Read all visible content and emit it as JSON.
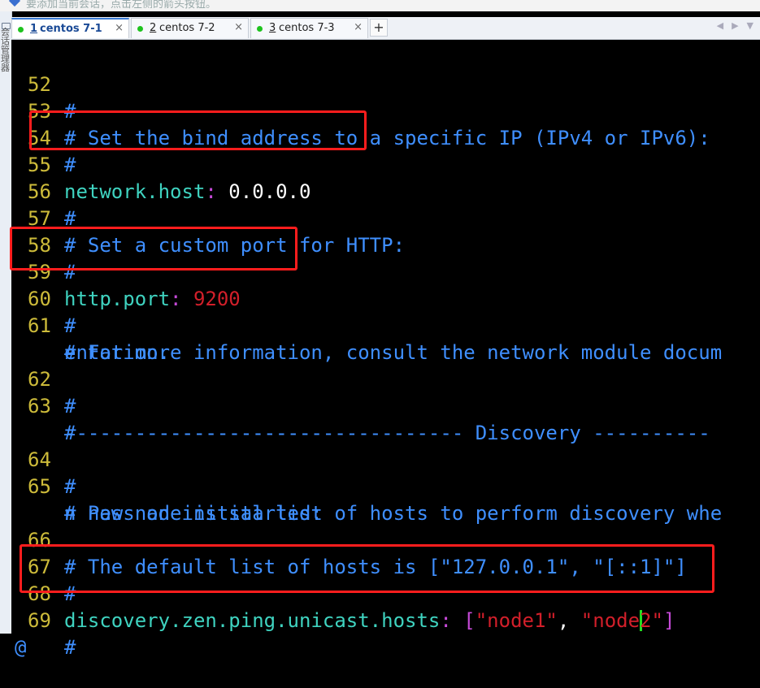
{
  "app": {
    "top_hint": "要添加当前会话，点击左侧的箭头按钮。",
    "side_label": "会话管理器"
  },
  "tabs": [
    {
      "num": "1",
      "label": "centos 7-1",
      "close": "×",
      "active": true
    },
    {
      "num": "2",
      "label": "centos 7-2",
      "close": "×",
      "active": false
    },
    {
      "num": "3",
      "label": "centos 7-3",
      "close": "×",
      "active": false
    }
  ],
  "add_tab_label": "+",
  "nav": {
    "prev": "◀",
    "next": "▶",
    "menu": "▼"
  },
  "terminal": {
    "lines": [
      {
        "num": "52",
        "text": "#"
      },
      {
        "num": "53",
        "text": "# Set the bind address to a specific IP (IPv4 or IPv6):"
      },
      {
        "num": "54",
        "text": "#"
      },
      {
        "num": "55",
        "key": "network.host",
        "colon": ":",
        "value": "0.0.0.0"
      },
      {
        "num": "56",
        "text": "#"
      },
      {
        "num": "57",
        "text": "# Set a custom port for HTTP:"
      },
      {
        "num": "58",
        "text": "#"
      },
      {
        "num": "59",
        "key": "http.port",
        "colon": ":",
        "value": "9200"
      },
      {
        "num": "60",
        "text": "#"
      },
      {
        "num": "61",
        "text": "# For more information, consult the network module docum",
        "cont": "entation."
      },
      {
        "num": "62",
        "text": "#"
      },
      {
        "num": "63",
        "text": "# -------------------------------- Discovery ----------",
        "cont": "----------------------"
      },
      {
        "num": "64",
        "text": "#"
      },
      {
        "num": "65",
        "text": "# Pass an initial list of hosts to perform discovery whe",
        "cont": "n new node is started:"
      },
      {
        "num": "66",
        "text": "# The default list of hosts is [\"127.0.0.1\", \"[::1]\"]"
      },
      {
        "num": "67",
        "text": "#"
      },
      {
        "num": "68",
        "key": "discovery.zen.ping.unicast.hosts",
        "colon": ":",
        "open": "[",
        "s1": "\"node1\"",
        "comma": ", ",
        "s2a": "\"node",
        "s2b": "2\"",
        "close": "]"
      },
      {
        "num": "69",
        "text": "#"
      }
    ],
    "last_line": "@"
  },
  "colors": {
    "line_number": "#cdbb3a",
    "comment": "#3f8fff",
    "yaml_key": "#3fd3c0",
    "colon": "#c64ad8",
    "string_value": "#d21f2a",
    "highlight_box": "#ff1d1d",
    "cursor": "#22e022"
  }
}
